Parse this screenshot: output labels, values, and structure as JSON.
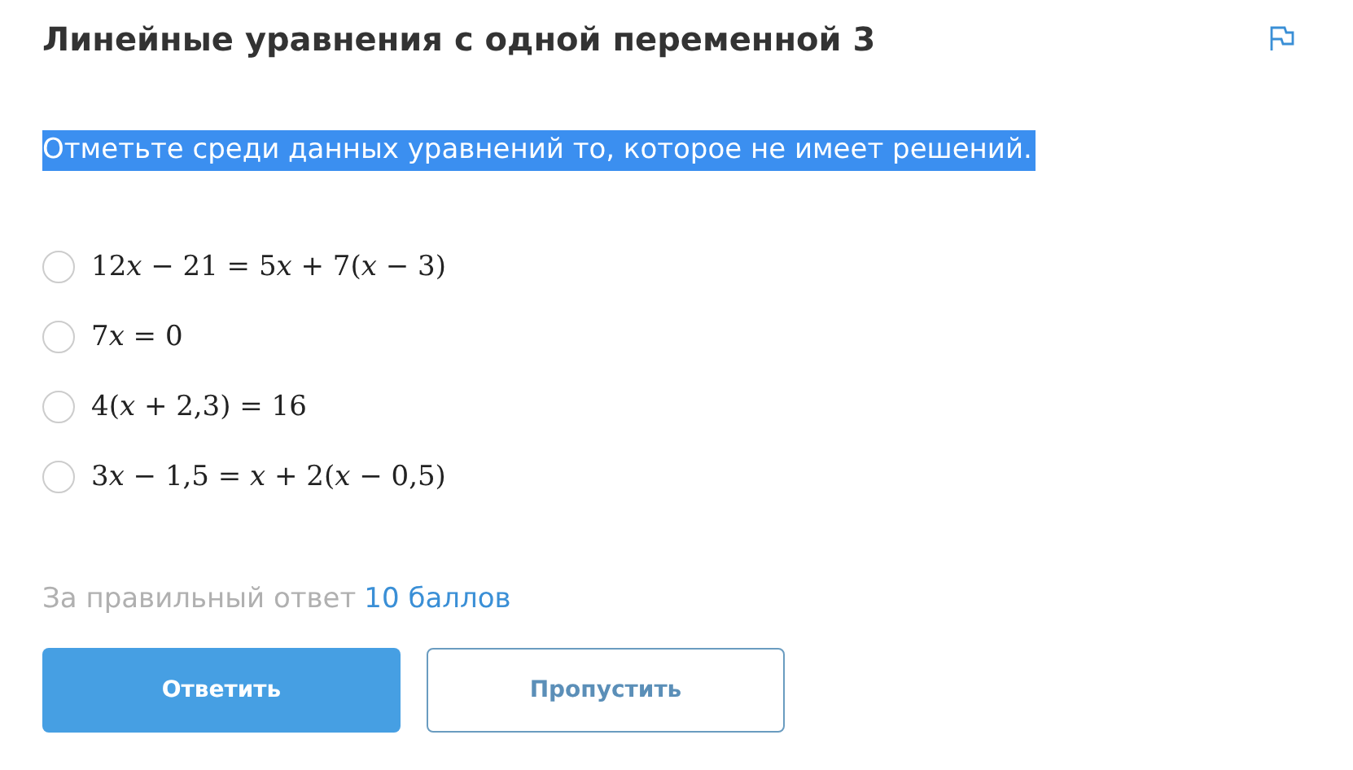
{
  "title": "Линейные уравнения с одной переменной 3",
  "prompt": {
    "text": "Отметьте среди данных уравнений то, которое не имеет решений.",
    "highlighted": true
  },
  "options": [
    {
      "formula": "12𝑥 − 21 = 5𝑥 + 7(𝑥 − 3)",
      "selected": false
    },
    {
      "formula": "7𝑥 = 0",
      "selected": false
    },
    {
      "formula": "4(𝑥 + 2,3) = 16",
      "selected": false
    },
    {
      "formula": "3𝑥 − 1,5 = 𝑥 + 2(𝑥 − 0,5)",
      "selected": false
    }
  ],
  "score": {
    "label": "За правильный ответ",
    "points": "10 баллов"
  },
  "buttons": [
    {
      "label": "Ответить",
      "kind": "primary"
    },
    {
      "label": "Пропустить",
      "kind": "secondary"
    }
  ]
}
